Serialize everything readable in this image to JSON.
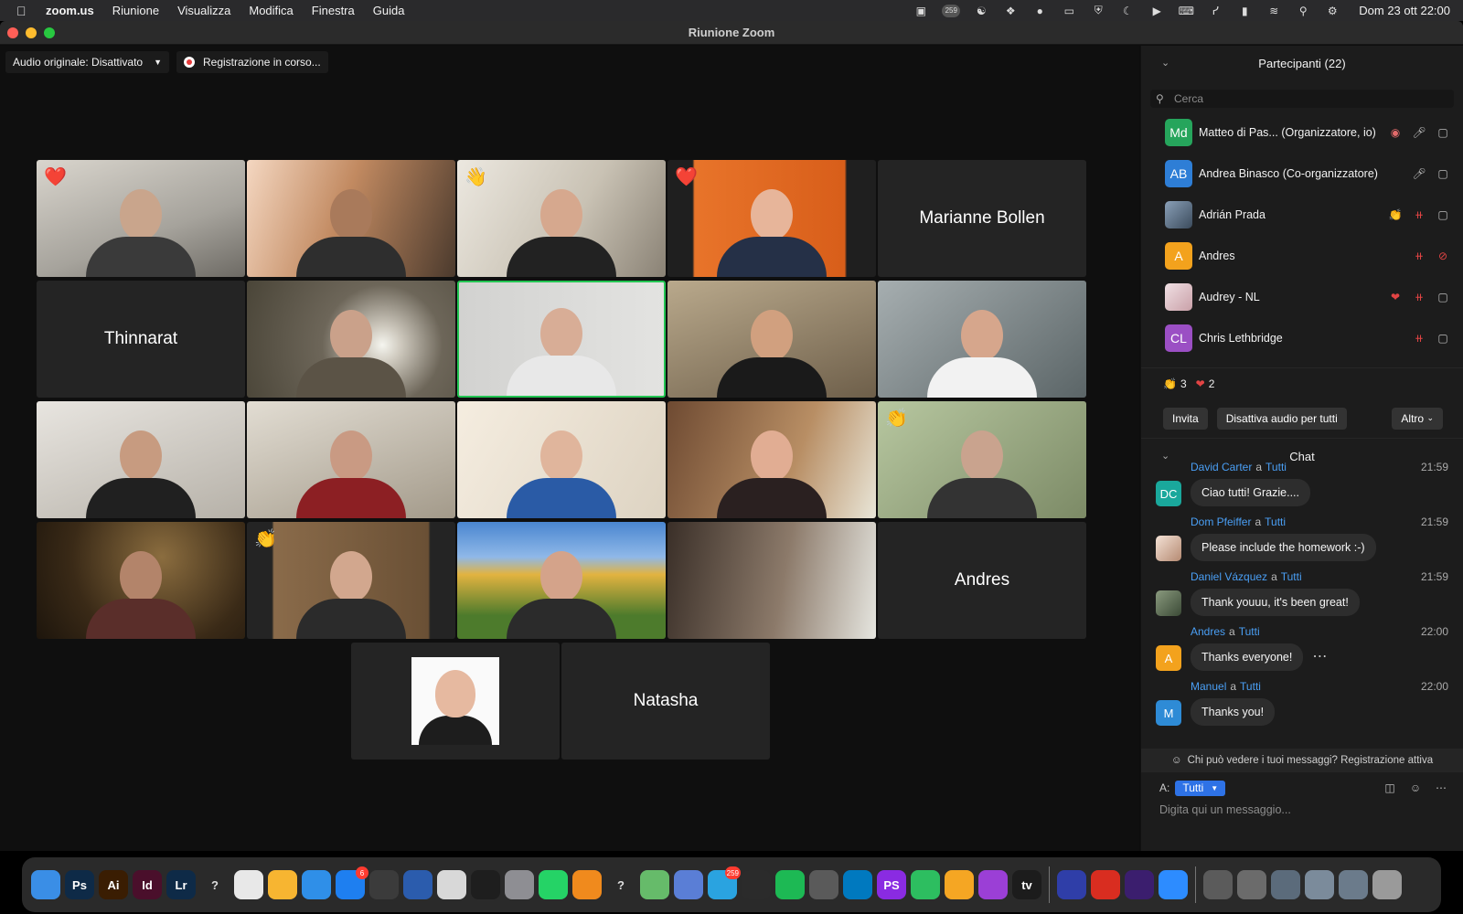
{
  "menubar": {
    "app": "zoom.us",
    "items": [
      "Riunione",
      "Visualizza",
      "Modifica",
      "Finestra",
      "Guida"
    ],
    "tray_badge": "259",
    "clock": "Dom 23 ott  22:00"
  },
  "window": {
    "title": "Riunione Zoom"
  },
  "chips": {
    "audio": "Audio originale: Disattivato",
    "recording": "Registrazione in corso..."
  },
  "tiles": {
    "marianne": "Marianne Bollen",
    "thinnarat": "Thinnarat",
    "andres": "Andres",
    "natasha": "Natasha"
  },
  "participants": {
    "header": "Partecipanti (22)",
    "search_placeholder": "Cerca",
    "list": [
      {
        "initials": "Md",
        "name": "Matteo di Pas...  (Organizzatore, io)",
        "color": "#26a55c"
      },
      {
        "initials": "AB",
        "name": "Andrea Binasco (Co-organizzatore)",
        "color": "#2e7ed6"
      },
      {
        "initials": "",
        "name": "Adrián Prada",
        "color": "#5a6b7c"
      },
      {
        "initials": "A",
        "name": "Andres",
        "color": "#f3a21d"
      },
      {
        "initials": "",
        "name": "Audrey - NL",
        "color": "#d9c3c6"
      },
      {
        "initials": "CL",
        "name": "Chris Lethbridge",
        "color": "#9b4fc4"
      }
    ],
    "reaction_clap_count": "3",
    "reaction_heart_count": "2",
    "invite": "Invita",
    "mute_all": "Disattiva audio per tutti",
    "more": "Altro"
  },
  "chat": {
    "header": "Chat",
    "messages": [
      {
        "from": "David Carter",
        "to": "Tutti",
        "time": "21:59",
        "text": "Ciao tutti! Grazie....",
        "avatar": "DC",
        "color": "#1aa89c"
      },
      {
        "from": "Dom Pfeiffer",
        "to": "Tutti",
        "time": "21:59",
        "text": "Please include the homework :-)",
        "avatar": "",
        "color": "#e8d0c0"
      },
      {
        "from": "Daniel Vázquez",
        "to": "Tutti",
        "time": "21:59",
        "text": "Thank youuu, it's been great!",
        "avatar": "",
        "color": "#4d5a4a"
      },
      {
        "from": "Andres",
        "to": "Tutti",
        "time": "22:00",
        "text": "Thanks everyone!",
        "avatar": "A",
        "color": "#f3a21d"
      },
      {
        "from": "Manuel",
        "to": "Tutti",
        "time": "22:00",
        "text": "Thanks you!",
        "avatar": "M",
        "color": "#2e8bd6"
      }
    ],
    "connector": "a",
    "privacy": "Chi può vedere i tuoi messaggi? Registrazione attiva",
    "to_label": "A:",
    "to_value": "Tutti",
    "input_placeholder": "Digita qui un messaggio..."
  },
  "dock": {
    "apps": [
      {
        "name": "finder",
        "label": "",
        "color": "#3a8ee6"
      },
      {
        "name": "photoshop",
        "label": "Ps",
        "color": "#0e2a47"
      },
      {
        "name": "illustrator",
        "label": "Ai",
        "color": "#3a1d02"
      },
      {
        "name": "indesign",
        "label": "Id",
        "color": "#4a0f2b"
      },
      {
        "name": "lightroom",
        "label": "Lr",
        "color": "#0e2a47"
      },
      {
        "name": "unknown-app",
        "label": "?",
        "color": "transparent"
      },
      {
        "name": "chrome",
        "label": "",
        "color": "#e8e8e8"
      },
      {
        "name": "sketch",
        "label": "",
        "color": "#f7b531"
      },
      {
        "name": "keynote",
        "label": "",
        "color": "#2f8fe8"
      },
      {
        "name": "app-store",
        "label": "",
        "color": "#1e7ff0",
        "badge": "6"
      },
      {
        "name": "sublime",
        "label": "",
        "color": "#3b3b3b"
      },
      {
        "name": "word",
        "label": "",
        "color": "#2b5cad"
      },
      {
        "name": "script-editor",
        "label": "",
        "color": "#d8d8d8"
      },
      {
        "name": "terminal",
        "label": "",
        "color": "#1e1e1e"
      },
      {
        "name": "system-preferences",
        "label": "",
        "color": "#8e8e93"
      },
      {
        "name": "whatsapp",
        "label": "",
        "color": "#25d366"
      },
      {
        "name": "vlc",
        "label": "",
        "color": "#f08a1d"
      },
      {
        "name": "unknown-app-2",
        "label": "?",
        "color": "transparent"
      },
      {
        "name": "atom",
        "label": "",
        "color": "#66bb6a"
      },
      {
        "name": "virtualbox",
        "label": "",
        "color": "#5a7ed6"
      },
      {
        "name": "telegram",
        "label": "",
        "color": "#2aa3e0",
        "badge": "259"
      },
      {
        "name": "activity-monitor",
        "label": "",
        "color": "#2b2b2b"
      },
      {
        "name": "spotify",
        "label": "",
        "color": "#1db954"
      },
      {
        "name": "calculator",
        "label": "",
        "color": "#5a5a5a"
      },
      {
        "name": "trello",
        "label": "",
        "color": "#0079bf"
      },
      {
        "name": "phpstorm",
        "label": "PS",
        "color": "#8a2be2"
      },
      {
        "name": "evernote",
        "label": "",
        "color": "#2dbe60"
      },
      {
        "name": "tableplus",
        "label": "",
        "color": "#f5a623"
      },
      {
        "name": "podcasts",
        "label": "",
        "color": "#9b3fd6"
      },
      {
        "name": "apple-tv",
        "label": "tv",
        "color": "#1c1c1c"
      },
      {
        "name": "sep",
        "label": "",
        "color": ""
      },
      {
        "name": "audio-app",
        "label": "",
        "color": "#2f3ea8"
      },
      {
        "name": "acrobat",
        "label": "",
        "color": "#d92d20"
      },
      {
        "name": "media-app",
        "label": "",
        "color": "#3b1e6e"
      },
      {
        "name": "zoom",
        "label": "",
        "color": "#2d8cff"
      },
      {
        "name": "sep",
        "label": "",
        "color": ""
      },
      {
        "name": "folder-downloads",
        "label": "",
        "color": "#5b5b5b"
      },
      {
        "name": "folder-documents",
        "label": "",
        "color": "#6b6b6b"
      },
      {
        "name": "folder-desktop",
        "label": "",
        "color": "#5b6b7b"
      },
      {
        "name": "folder-stack",
        "label": "",
        "color": "#7b8b9b"
      },
      {
        "name": "folder-stack-2",
        "label": "",
        "color": "#6b7b8b"
      },
      {
        "name": "trash",
        "label": "",
        "color": "#9a9a9a"
      }
    ]
  }
}
